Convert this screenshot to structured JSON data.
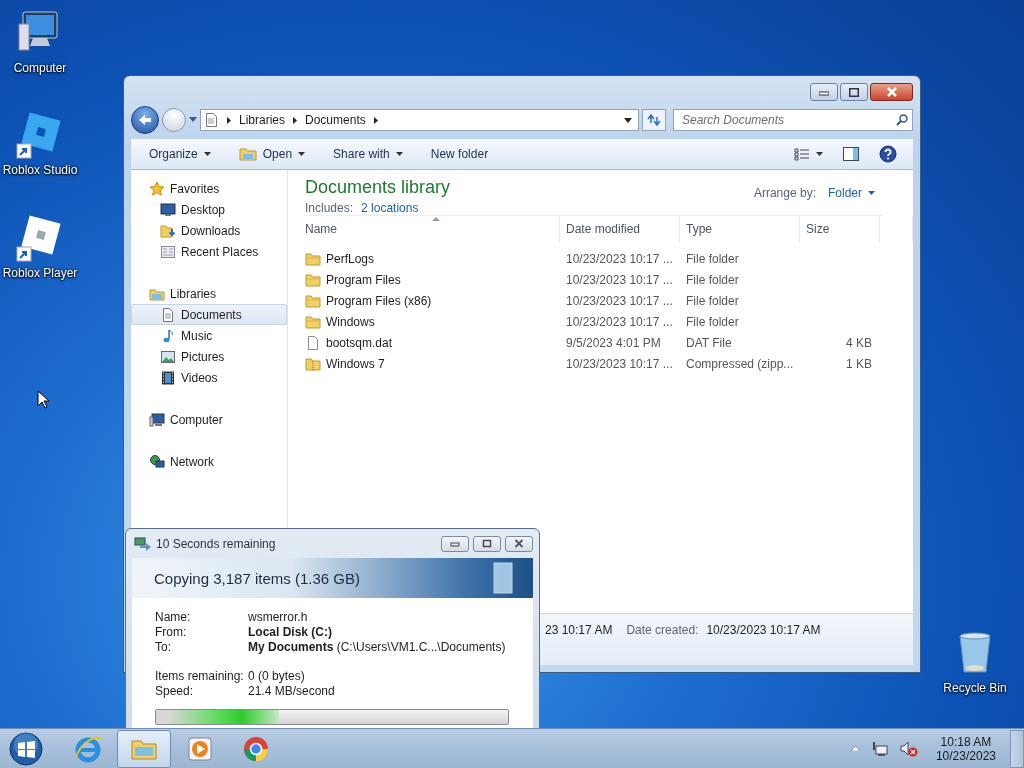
{
  "desktop_icons": [
    {
      "label": "Computer",
      "kind": "computer"
    },
    {
      "label": "Roblox Studio",
      "kind": "studio"
    },
    {
      "label": "Roblox Player",
      "kind": "player"
    },
    {
      "label": "Recycle Bin",
      "kind": "bin"
    }
  ],
  "explorer": {
    "breadcrumb": [
      "Libraries",
      "Documents"
    ],
    "search": {
      "placeholder": "Search Documents"
    },
    "toolbar": [
      {
        "label": "Organize",
        "kind": "menu"
      },
      {
        "label": "Open",
        "kind": "open"
      },
      {
        "label": "Share with",
        "kind": "menu"
      },
      {
        "label": "New folder",
        "kind": "plain"
      }
    ],
    "sidebar": [
      {
        "label": "Favorites",
        "kind": "star",
        "selected": false,
        "children": [
          {
            "label": "Desktop",
            "kind": "desktop",
            "selected": false
          },
          {
            "label": "Downloads",
            "kind": "downloads",
            "selected": false
          },
          {
            "label": "Recent Places",
            "kind": "recent",
            "selected": false
          }
        ]
      },
      {
        "label": "Libraries",
        "kind": "libraries",
        "selected": false,
        "children": [
          {
            "label": "Documents",
            "kind": "documents",
            "selected": true
          },
          {
            "label": "Music",
            "kind": "music",
            "selected": false
          },
          {
            "label": "Pictures",
            "kind": "pictures",
            "selected": false
          },
          {
            "label": "Videos",
            "kind": "videos",
            "selected": false
          }
        ]
      },
      {
        "label": "Computer",
        "kind": "computer",
        "selected": false
      },
      {
        "label": "Network",
        "kind": "network",
        "selected": false
      }
    ],
    "library": {
      "title": "Documents library",
      "includes_label": "Includes:",
      "includes_link": "2 locations",
      "arrange_label": "Arrange by:",
      "arrange_value": "Folder"
    },
    "table": {
      "columns": [
        {
          "label": "Name",
          "sorted": true
        },
        {
          "label": "Date modified",
          "sorted": false
        },
        {
          "label": "Type",
          "sorted": false
        },
        {
          "label": "Size",
          "sorted": false
        }
      ],
      "rows": [
        {
          "kind": "folder",
          "name": "PerfLogs",
          "date_modified": "10/23/2023 10:17 ...",
          "type": "File folder"
        },
        {
          "kind": "folder",
          "name": "Program Files",
          "date_modified": "10/23/2023 10:17 ...",
          "type": "File folder"
        },
        {
          "kind": "folder",
          "name": "Program Files (x86)",
          "date_modified": "10/23/2023 10:17 ...",
          "type": "File folder"
        },
        {
          "kind": "folder",
          "name": "Windows",
          "date_modified": "10/23/2023 10:17 ...",
          "type": "File folder"
        },
        {
          "kind": "file",
          "name": "bootsqm.dat",
          "date_modified": "9/5/2023 4:01 PM",
          "type": "DAT File",
          "size": "4 KB"
        },
        {
          "kind": "zip",
          "name": "Windows 7",
          "date_modified": "10/23/2023 10:17 ...",
          "type": "Compressed (zipp...",
          "size": "1 KB"
        }
      ]
    },
    "details": {
      "modified_fragment": "23 10:17 AM",
      "created_label": "Date created:",
      "created_value": "10/23/2023 10:17 AM"
    }
  },
  "copy_dialog": {
    "title": "10 Seconds remaining",
    "heading": "Copying 3,187 items (1.36 GB)",
    "file_fields": [
      {
        "label": "Name:",
        "value": "wsmerror.h",
        "bold": false
      },
      {
        "label": "From:",
        "value": "Local Disk (C:)",
        "bold": true
      },
      {
        "label": "To:",
        "value": "**My Documents** (C:\\Users\\VM1.C...\\Documents)",
        "bold": false
      }
    ],
    "progress_fields": [
      {
        "label": "Items remaining:",
        "value": "0 (0 bytes)",
        "bold": false
      },
      {
        "label": "Speed:",
        "value": "21.4 MB/second",
        "bold": false
      }
    ],
    "progress": {
      "level": 0.35
    }
  },
  "taskbar": {
    "pinned": [
      {
        "kind": "ie",
        "selected": false
      },
      {
        "kind": "explorer",
        "selected": true
      },
      {
        "kind": "media",
        "selected": false
      },
      {
        "kind": "chrome",
        "selected": false
      }
    ],
    "clock": {
      "time": "10:18 AM",
      "date": "10/23/2023"
    }
  }
}
